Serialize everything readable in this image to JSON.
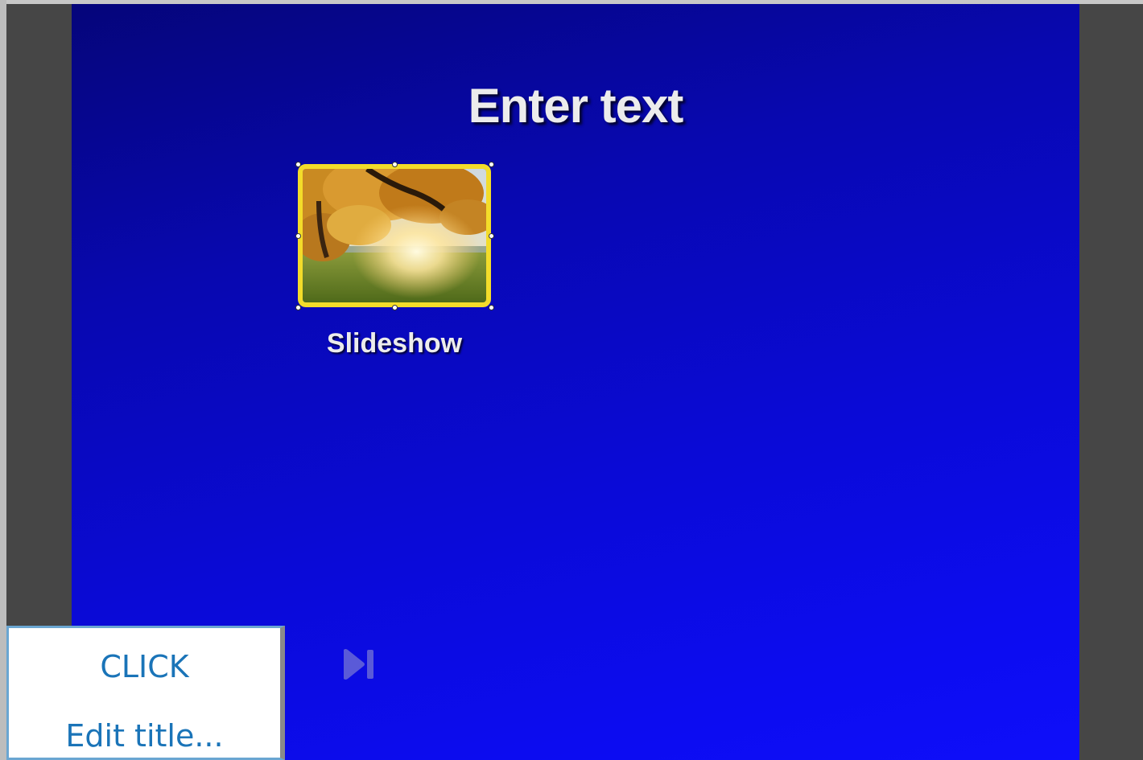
{
  "slide": {
    "title": "Enter text",
    "button_label": "Slideshow"
  },
  "popup_menu": {
    "items": [
      "CLICK",
      "Edit title..."
    ]
  },
  "icons": {
    "thumbnail": "autumn-tree-photo",
    "next": "skip-next-icon"
  },
  "colors": {
    "slide_gradient_start": "#05057a",
    "slide_gradient_end": "#0e0efa",
    "thumbnail_border": "#f3dc2a",
    "menu_text": "#1a74b8",
    "frame_background": "#464646"
  }
}
